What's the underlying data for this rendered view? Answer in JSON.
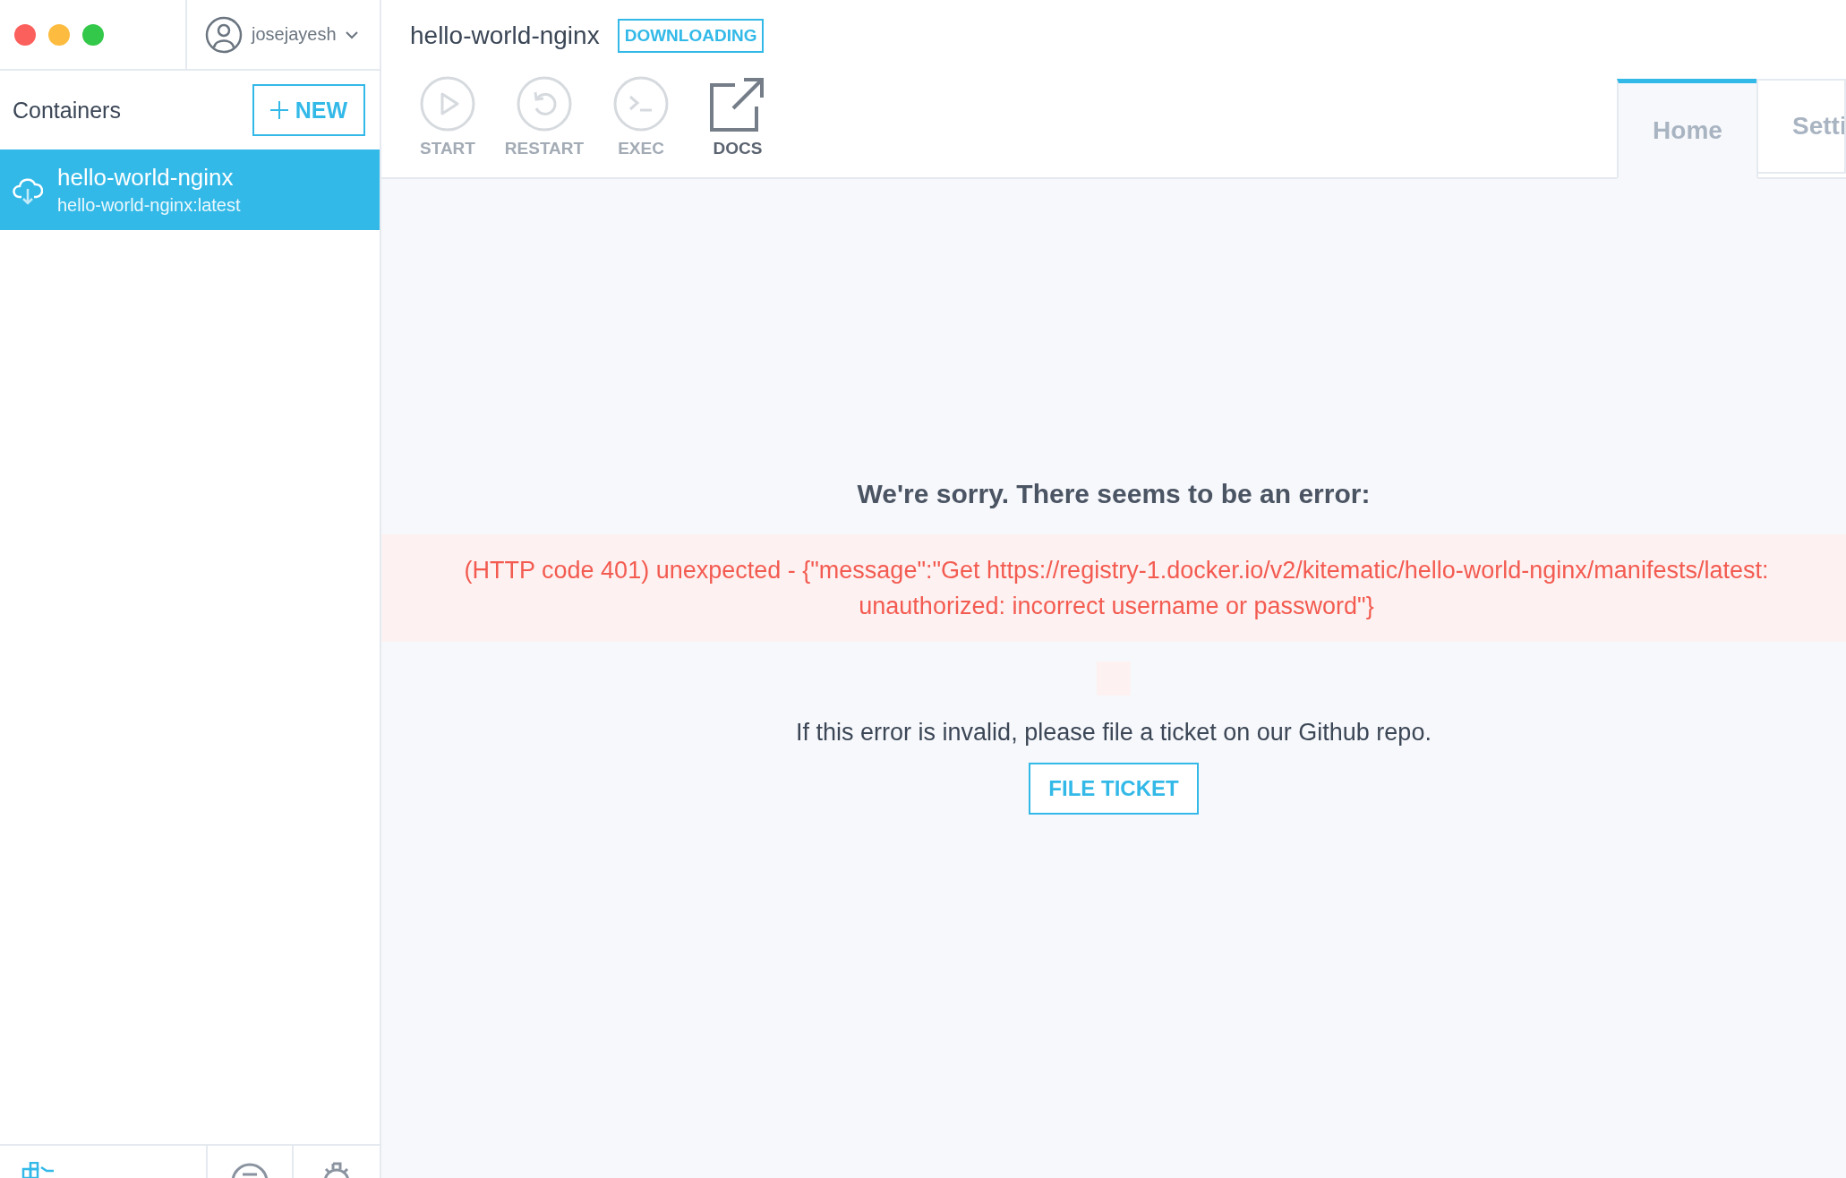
{
  "window": {
    "controls": [
      {
        "kind": "close"
      },
      {
        "kind": "minimize"
      },
      {
        "kind": "zoom"
      }
    ]
  },
  "account": {
    "username": "josejayesh"
  },
  "sidebar": {
    "title": "Containers",
    "new_button": "NEW",
    "items": [
      {
        "name": "hello-world-nginx",
        "image": "hello-world-nginx:latest",
        "selected": true
      }
    ],
    "footer": [
      {
        "kind": "whale"
      },
      {
        "kind": "chat"
      },
      {
        "kind": "settings"
      }
    ]
  },
  "header": {
    "title": "hello-world-nginx",
    "status": "DOWNLOADING"
  },
  "toolbar": [
    {
      "kind": "start",
      "label": "START",
      "disabled": true
    },
    {
      "kind": "restart",
      "label": "RESTART",
      "disabled": true
    },
    {
      "kind": "exec",
      "label": "EXEC",
      "disabled": true
    },
    {
      "kind": "docs",
      "label": "DOCS",
      "disabled": false
    }
  ],
  "tabs": [
    {
      "label": "Home",
      "selected": true
    },
    {
      "label": "Setti",
      "selected": false
    }
  ],
  "error": {
    "heading": "We're sorry. There seems to be an error:",
    "message": "(HTTP code 401) unexpected - {\"message\":\"Get https://registry-1.docker.io/v2/kitematic/hello-world-nginx/manifests/latest: unauthorized: incorrect username or password\"}",
    "hint": "If this error is invalid, please file a ticket on our Github repo.",
    "button": "FILE TICKET"
  }
}
